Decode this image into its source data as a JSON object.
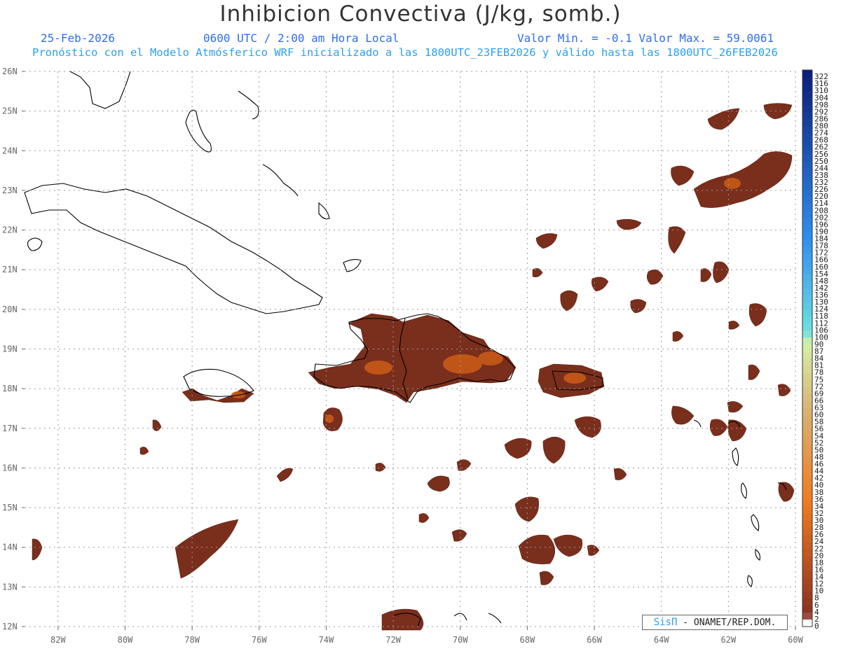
{
  "header": {
    "title": "Inhibicion Convectiva (J/kg, somb.)",
    "date": "25-Feb-2026",
    "time": "0600 UTC / 2:00 am Hora Local",
    "minmax": "Valor Min. = -0.1  Valor Max. = 59.0061",
    "forecast": "Pronóstico con el Modelo Atmósferico WRF inicializado a las 1800UTC_23FEB2026 y válido hasta las  1800UTC_26FEB2026"
  },
  "credit": {
    "brand": "SisΠ",
    "text": " - ONAMET/REP.DOM."
  },
  "map": {
    "lat_labels": [
      "26N",
      "25N",
      "24N",
      "23N",
      "22N",
      "21N",
      "20N",
      "19N",
      "18N",
      "17N",
      "16N",
      "15N",
      "14N",
      "13N",
      "12N"
    ],
    "lon_labels": [
      "82W",
      "80W",
      "78W",
      "76W",
      "74W",
      "72W",
      "70W",
      "68W",
      "66W",
      "64W",
      "62W",
      "60W"
    ],
    "lat_range": [
      12,
      26
    ],
    "lon_range": [
      -83,
      -60
    ]
  },
  "colorbar": {
    "labels": [
      "322",
      "316",
      "310",
      "304",
      "298",
      "292",
      "286",
      "280",
      "274",
      "268",
      "262",
      "256",
      "250",
      "244",
      "238",
      "232",
      "226",
      "220",
      "214",
      "208",
      "202",
      "196",
      "190",
      "184",
      "178",
      "172",
      "166",
      "160",
      "154",
      "148",
      "142",
      "136",
      "130",
      "124",
      "118",
      "112",
      "106",
      "100",
      "90",
      "87",
      "84",
      "81",
      "78",
      "75",
      "72",
      "69",
      "66",
      "63",
      "60",
      "58",
      "56",
      "54",
      "52",
      "50",
      "48",
      "46",
      "44",
      "42",
      "40",
      "38",
      "36",
      "34",
      "32",
      "30",
      "28",
      "26",
      "24",
      "22",
      "20",
      "18",
      "16",
      "14",
      "12",
      "10",
      "8",
      "6",
      "4",
      "2",
      "0"
    ],
    "colors": {
      "blue_top": "#0a1f7a",
      "blue_mid": "#2f8ef0",
      "cyan": "#6fe0e0",
      "green": "#d4f0a8",
      "tan": "#d9b070",
      "orange": "#f07a20",
      "brown": "#8a3020"
    }
  },
  "field_color": "#7a2e1c",
  "field_highlight": "#c85a18"
}
